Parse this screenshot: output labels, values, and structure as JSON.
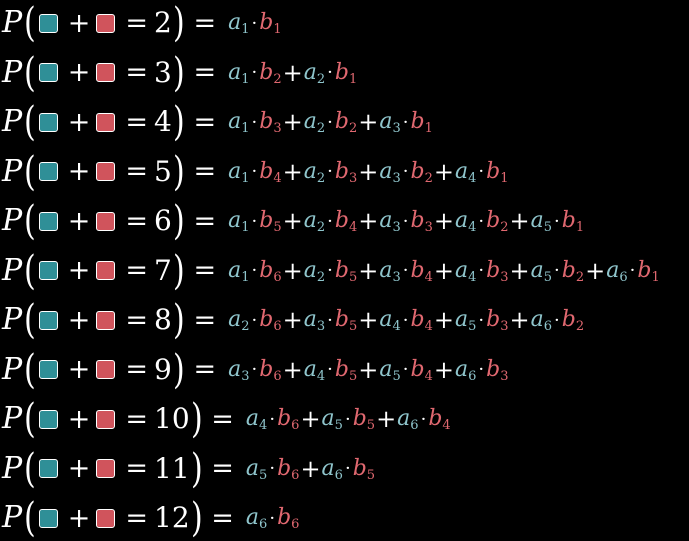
{
  "colors": {
    "background": "#000000",
    "a_color": "#8fc5cc",
    "b_color": "#e06870",
    "teal_square": "#2f8f97",
    "red_square": "#d0545c"
  },
  "symbols": {
    "P": "P",
    "plus": "+",
    "equals": "=",
    "dot": "·",
    "open_paren": "(",
    "close_paren": ")"
  },
  "rows": [
    {
      "sum": "2",
      "terms": [
        [
          "a",
          "1",
          "b",
          "1"
        ]
      ]
    },
    {
      "sum": "3",
      "terms": [
        [
          "a",
          "1",
          "b",
          "2"
        ],
        [
          "a",
          "2",
          "b",
          "1"
        ]
      ]
    },
    {
      "sum": "4",
      "terms": [
        [
          "a",
          "1",
          "b",
          "3"
        ],
        [
          "a",
          "2",
          "b",
          "2"
        ],
        [
          "a",
          "3",
          "b",
          "1"
        ]
      ]
    },
    {
      "sum": "5",
      "terms": [
        [
          "a",
          "1",
          "b",
          "4"
        ],
        [
          "a",
          "2",
          "b",
          "3"
        ],
        [
          "a",
          "3",
          "b",
          "2"
        ],
        [
          "a",
          "4",
          "b",
          "1"
        ]
      ]
    },
    {
      "sum": "6",
      "terms": [
        [
          "a",
          "1",
          "b",
          "5"
        ],
        [
          "a",
          "2",
          "b",
          "4"
        ],
        [
          "a",
          "3",
          "b",
          "3"
        ],
        [
          "a",
          "4",
          "b",
          "2"
        ],
        [
          "a",
          "5",
          "b",
          "1"
        ]
      ]
    },
    {
      "sum": "7",
      "terms": [
        [
          "a",
          "1",
          "b",
          "6"
        ],
        [
          "a",
          "2",
          "b",
          "5"
        ],
        [
          "a",
          "3",
          "b",
          "4"
        ],
        [
          "a",
          "4",
          "b",
          "3"
        ],
        [
          "a",
          "5",
          "b",
          "2"
        ],
        [
          "a",
          "6",
          "b",
          "1"
        ]
      ]
    },
    {
      "sum": "8",
      "terms": [
        [
          "a",
          "2",
          "b",
          "6"
        ],
        [
          "a",
          "3",
          "b",
          "5"
        ],
        [
          "a",
          "4",
          "b",
          "4"
        ],
        [
          "a",
          "5",
          "b",
          "3"
        ],
        [
          "a",
          "6",
          "b",
          "2"
        ]
      ]
    },
    {
      "sum": "9",
      "terms": [
        [
          "a",
          "3",
          "b",
          "6"
        ],
        [
          "a",
          "4",
          "b",
          "5"
        ],
        [
          "a",
          "5",
          "b",
          "4"
        ],
        [
          "a",
          "6",
          "b",
          "3"
        ]
      ]
    },
    {
      "sum": "10",
      "terms": [
        [
          "a",
          "4",
          "b",
          "6"
        ],
        [
          "a",
          "5",
          "b",
          "5"
        ],
        [
          "a",
          "6",
          "b",
          "4"
        ]
      ]
    },
    {
      "sum": "11",
      "terms": [
        [
          "a",
          "5",
          "b",
          "6"
        ],
        [
          "a",
          "6",
          "b",
          "5"
        ]
      ]
    },
    {
      "sum": "12",
      "terms": [
        [
          "a",
          "6",
          "b",
          "6"
        ]
      ]
    }
  ]
}
